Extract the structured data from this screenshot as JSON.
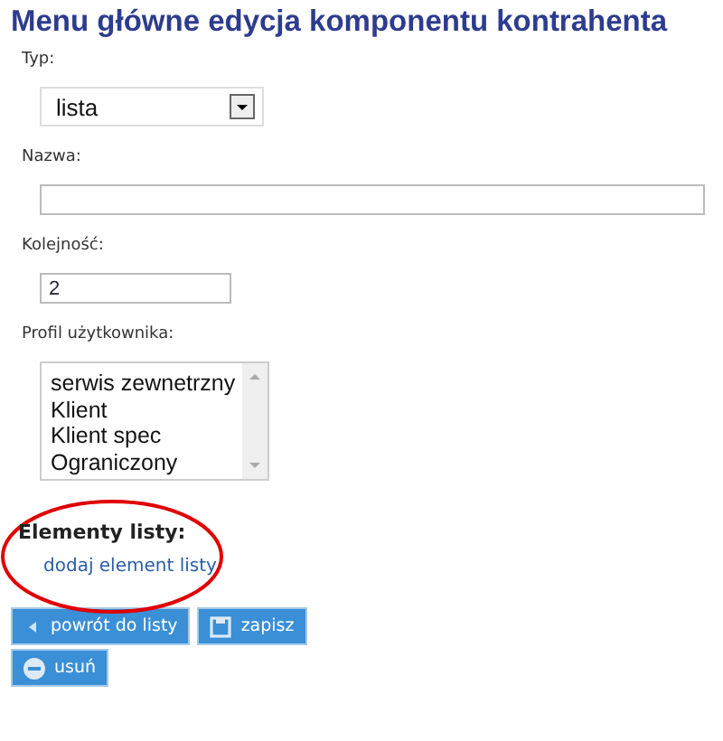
{
  "title": "Menu główne edycja komponentu kontrahenta",
  "fields": [
    {
      "kind": "select",
      "label": "Typ:",
      "value": "lista"
    },
    {
      "kind": "long_text",
      "label": "Nazwa:"
    },
    {
      "kind": "short_text",
      "label": "Kolejność:",
      "value": "2"
    },
    {
      "kind": "listbox",
      "label": "Profil użytkownika:",
      "options": [
        "serwis zewnetrzny",
        "Klient",
        "Klient spec",
        "Ograniczony"
      ]
    }
  ],
  "list_section": {
    "heading": "Elementy listy:",
    "link": "dodaj element listy"
  },
  "buttons": [
    {
      "kind": "back",
      "label": "powrót do listy"
    },
    {
      "kind": "save",
      "label": "zapisz"
    },
    {
      "kind": "delete",
      "label": "usuń"
    }
  ]
}
